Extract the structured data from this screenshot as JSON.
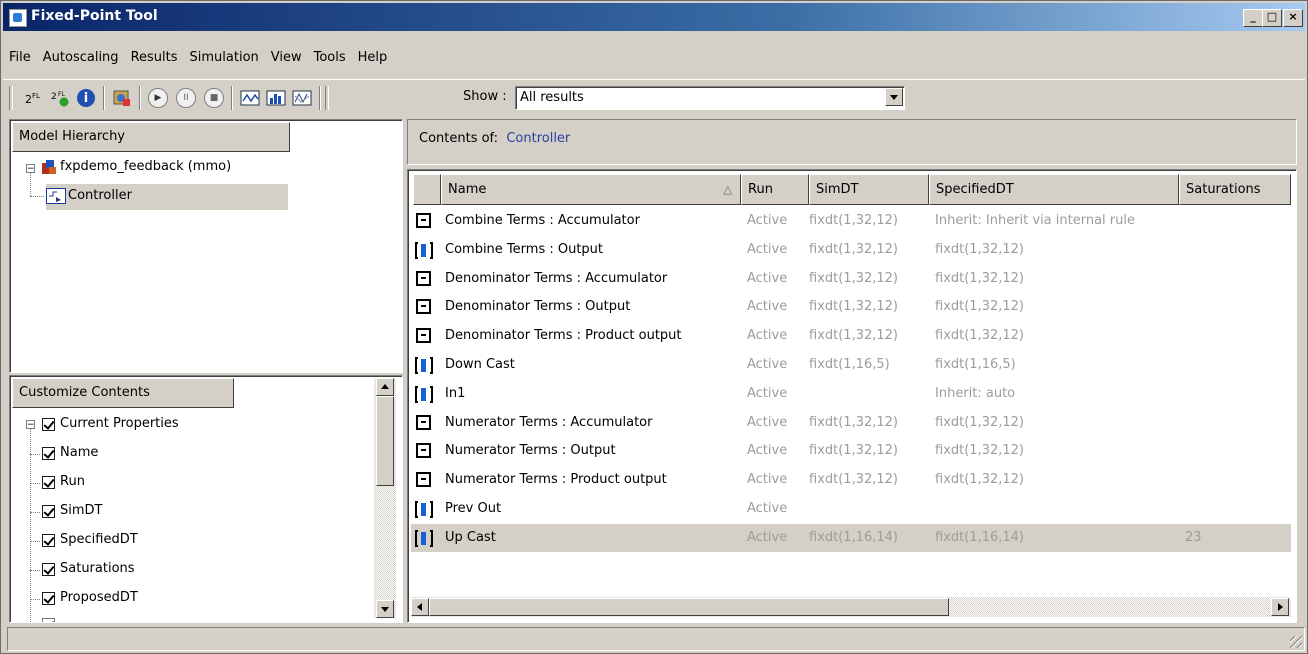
{
  "window": {
    "title": "Fixed-Point Tool"
  },
  "menu": [
    "File",
    "Autoscaling",
    "Results",
    "Simulation",
    "View",
    "Tools",
    "Help"
  ],
  "toolbar": {
    "show_label": "Show :",
    "show_value": "All results"
  },
  "model_hierarchy": {
    "header": "Model Hierarchy",
    "root": "fxpdemo_feedback (mmo)",
    "child": "Controller"
  },
  "customize": {
    "header": "Customize Contents",
    "root": "Current Properties",
    "items": [
      "Name",
      "Run",
      "SimDT",
      "SpecifiedDT",
      "Saturations",
      "ProposedDT"
    ]
  },
  "contents": {
    "label": "Contents of:",
    "target": "Controller",
    "columns": [
      "Name",
      "Run",
      "SimDT",
      "SpecifiedDT",
      "Saturations"
    ],
    "rows": [
      {
        "icon": "accumulator-icon",
        "name": "Combine Terms : Accumulator",
        "run": "Active",
        "simdt": "fixdt(1,32,12)",
        "specdt": "Inherit: Inherit via internal rule",
        "sat": ""
      },
      {
        "icon": "signal-icon",
        "name": "Combine Terms : Output",
        "run": "Active",
        "simdt": "fixdt(1,32,12)",
        "specdt": "fixdt(1,32,12)",
        "sat": ""
      },
      {
        "icon": "accumulator-icon",
        "name": "Denominator Terms : Accumulator",
        "run": "Active",
        "simdt": "fixdt(1,32,12)",
        "specdt": "fixdt(1,32,12)",
        "sat": ""
      },
      {
        "icon": "accumulator-icon",
        "name": "Denominator Terms : Output",
        "run": "Active",
        "simdt": "fixdt(1,32,12)",
        "specdt": "fixdt(1,32,12)",
        "sat": ""
      },
      {
        "icon": "accumulator-icon",
        "name": "Denominator Terms : Product output",
        "run": "Active",
        "simdt": "fixdt(1,32,12)",
        "specdt": "fixdt(1,32,12)",
        "sat": ""
      },
      {
        "icon": "signal-icon",
        "name": "Down Cast",
        "run": "Active",
        "simdt": "fixdt(1,16,5)",
        "specdt": "fixdt(1,16,5)",
        "sat": ""
      },
      {
        "icon": "signal-icon",
        "name": "In1",
        "run": "Active",
        "simdt": "",
        "specdt": "Inherit: auto",
        "sat": ""
      },
      {
        "icon": "accumulator-icon",
        "name": "Numerator Terms : Accumulator",
        "run": "Active",
        "simdt": "fixdt(1,32,12)",
        "specdt": "fixdt(1,32,12)",
        "sat": ""
      },
      {
        "icon": "accumulator-icon",
        "name": "Numerator Terms : Output",
        "run": "Active",
        "simdt": "fixdt(1,32,12)",
        "specdt": "fixdt(1,32,12)",
        "sat": ""
      },
      {
        "icon": "accumulator-icon",
        "name": "Numerator Terms : Product output",
        "run": "Active",
        "simdt": "fixdt(1,32,12)",
        "specdt": "fixdt(1,32,12)",
        "sat": ""
      },
      {
        "icon": "signal-icon",
        "name": "Prev Out",
        "run": "Active",
        "simdt": "",
        "specdt": "",
        "sat": ""
      },
      {
        "icon": "signal-icon",
        "name": "Up Cast",
        "run": "Active",
        "simdt": "fixdt(1,16,14)",
        "specdt": "fixdt(1,16,14)",
        "sat": "23",
        "selected": true
      }
    ]
  }
}
